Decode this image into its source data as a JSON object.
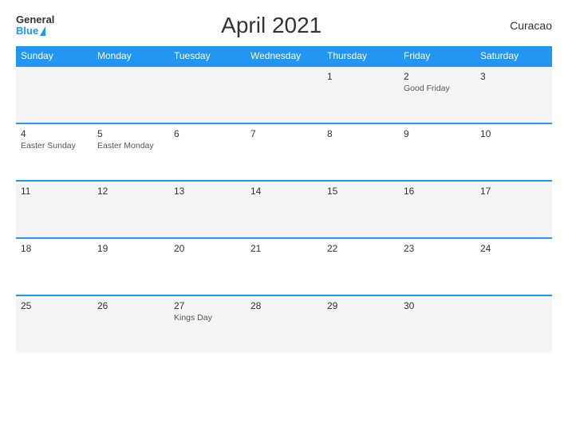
{
  "header": {
    "logo_general": "General",
    "logo_blue": "Blue",
    "title": "April 2021",
    "region": "Curacao"
  },
  "days_of_week": [
    "Sunday",
    "Monday",
    "Tuesday",
    "Wednesday",
    "Thursday",
    "Friday",
    "Saturday"
  ],
  "weeks": [
    [
      {
        "day": "",
        "holiday": ""
      },
      {
        "day": "",
        "holiday": ""
      },
      {
        "day": "",
        "holiday": ""
      },
      {
        "day": "",
        "holiday": ""
      },
      {
        "day": "1",
        "holiday": ""
      },
      {
        "day": "2",
        "holiday": "Good Friday"
      },
      {
        "day": "3",
        "holiday": ""
      }
    ],
    [
      {
        "day": "4",
        "holiday": "Easter Sunday"
      },
      {
        "day": "5",
        "holiday": "Easter Monday"
      },
      {
        "day": "6",
        "holiday": ""
      },
      {
        "day": "7",
        "holiday": ""
      },
      {
        "day": "8",
        "holiday": ""
      },
      {
        "day": "9",
        "holiday": ""
      },
      {
        "day": "10",
        "holiday": ""
      }
    ],
    [
      {
        "day": "11",
        "holiday": ""
      },
      {
        "day": "12",
        "holiday": ""
      },
      {
        "day": "13",
        "holiday": ""
      },
      {
        "day": "14",
        "holiday": ""
      },
      {
        "day": "15",
        "holiday": ""
      },
      {
        "day": "16",
        "holiday": ""
      },
      {
        "day": "17",
        "holiday": ""
      }
    ],
    [
      {
        "day": "18",
        "holiday": ""
      },
      {
        "day": "19",
        "holiday": ""
      },
      {
        "day": "20",
        "holiday": ""
      },
      {
        "day": "21",
        "holiday": ""
      },
      {
        "day": "22",
        "holiday": ""
      },
      {
        "day": "23",
        "holiday": ""
      },
      {
        "day": "24",
        "holiday": ""
      }
    ],
    [
      {
        "day": "25",
        "holiday": ""
      },
      {
        "day": "26",
        "holiday": ""
      },
      {
        "day": "27",
        "holiday": "Kings Day"
      },
      {
        "day": "28",
        "holiday": ""
      },
      {
        "day": "29",
        "holiday": ""
      },
      {
        "day": "30",
        "holiday": ""
      },
      {
        "day": "",
        "holiday": ""
      }
    ]
  ]
}
